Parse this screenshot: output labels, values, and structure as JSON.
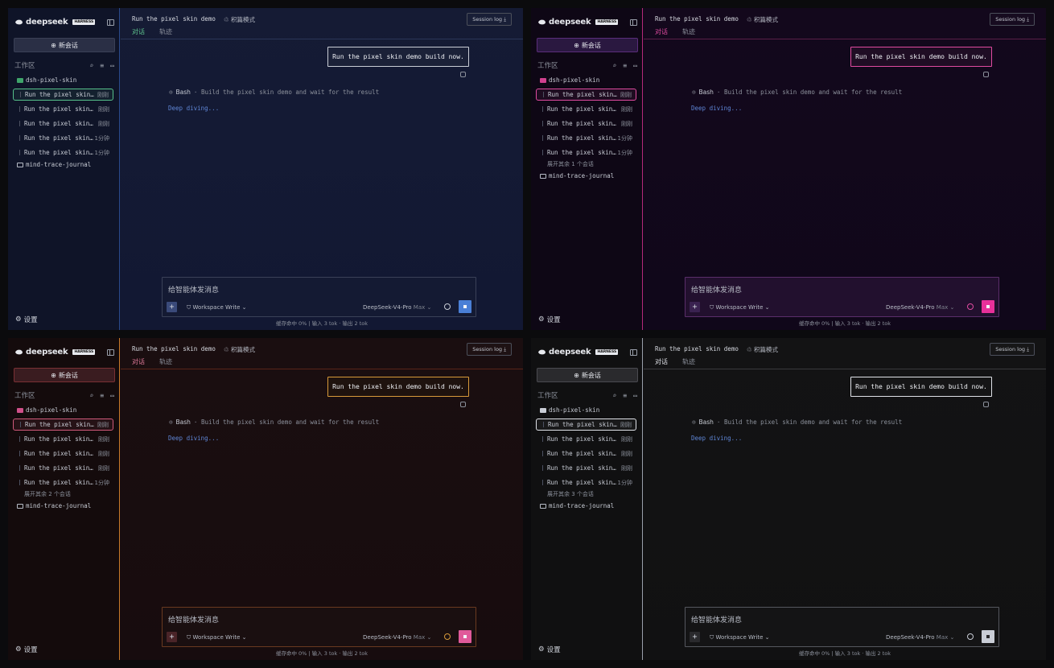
{
  "brand": {
    "name": "deepseek",
    "badge": "HARNESS"
  },
  "sidebar": {
    "new_chat": "新会话",
    "workspace": "工作区",
    "settings": "设置",
    "project_open": "dsh-pixel-skin",
    "project_closed": "mind-trace-journal",
    "session_name": "Run the pixel skin…",
    "time_now": "刚刚",
    "time_1min": "1分钟"
  },
  "main": {
    "title": "Run the pixel skin demo",
    "plan_mode": "♲ 积篇模式",
    "session_log": "Session log ⤓",
    "tabs": [
      "对话",
      "轨迹"
    ],
    "user_message": "Run the pixel skin demo build now.",
    "tool_name": "Bash",
    "tool_desc": "· Build the pixel skin demo and wait for the result",
    "thinking_a": "Deep",
    "thinking_b": "diving...",
    "composer_placeholder": "给智能体发消息",
    "workspace_write": "Workspace Write ⌄",
    "model": "DeepSeek-V4-Pro",
    "model_max": "Max ⌄",
    "footer": "缓存命中 0% | 输入 3 tok · 输出 2 tok"
  },
  "panels": [
    {
      "theme": "t-blue",
      "expand_more": "",
      "times": [
        "刚刚",
        "刚刚",
        "刚刚",
        "1分钟",
        "1分钟"
      ]
    },
    {
      "theme": "t-pink",
      "expand_more": "展开其余 1 个会话",
      "times": [
        "刚刚",
        "刚刚",
        "刚刚",
        "1分钟",
        "1分钟"
      ]
    },
    {
      "theme": "t-red",
      "expand_more": "展开其余 2 个会话",
      "times": [
        "刚刚",
        "刚刚",
        "刚刚",
        "刚刚",
        "1分钟"
      ]
    },
    {
      "theme": "t-gray",
      "expand_more": "展开其余 3 个会话",
      "times": [
        "刚刚",
        "刚刚",
        "刚刚",
        "刚刚",
        "1分钟"
      ]
    }
  ],
  "colors": {
    "blue_accent": "#5ec48e",
    "pink_accent": "#e04ba0",
    "red_accent": "#d89a3a",
    "gray_accent": "#e0e2e8"
  }
}
